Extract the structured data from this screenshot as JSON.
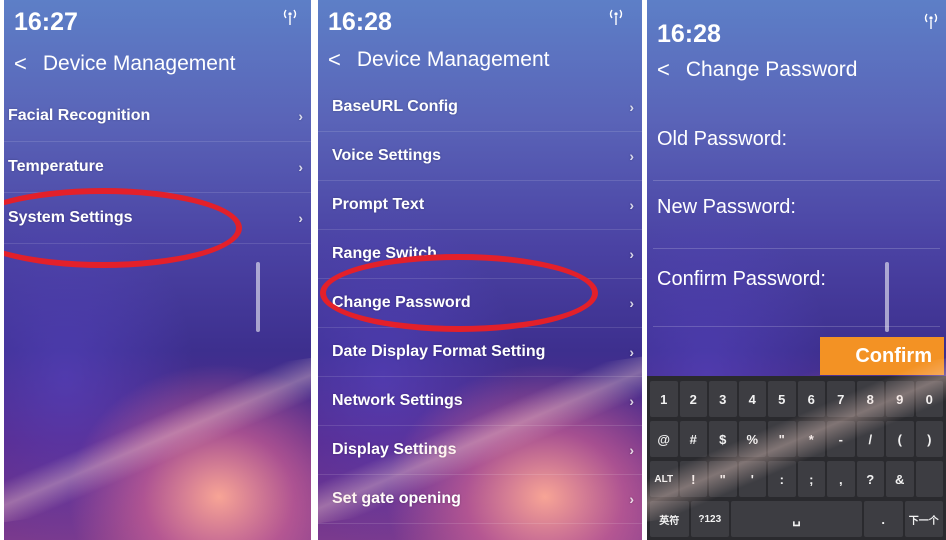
{
  "screens": [
    {
      "time": "16:27",
      "header_title": "Device Management",
      "menu_items": [
        "Facial Recognition",
        "Temperature",
        "System Settings"
      ]
    },
    {
      "time": "16:28",
      "header_title": "Device Management",
      "menu_items": [
        "BaseURL Config",
        "Voice Settings",
        "Prompt Text",
        "Range Switch",
        "Change Password",
        "Date Display Format Setting",
        "Network Settings",
        "Display Settings",
        "Set gate opening"
      ]
    },
    {
      "time": "16:28",
      "header_title": "Change Password",
      "fields": {
        "old_password": "Old Password:",
        "new_password": "New Password:",
        "confirm_password": "Confirm Password:"
      },
      "confirm_label": "Confirm",
      "keyboard": {
        "row1": [
          "1",
          "2",
          "3",
          "4",
          "5",
          "6",
          "7",
          "8",
          "9",
          "0"
        ],
        "row2": [
          "@",
          "#",
          "$",
          "%",
          "\"",
          "*",
          "-",
          "/",
          "(",
          ")"
        ],
        "row3": [
          "ALT",
          "!",
          "\"",
          "'",
          ":",
          ";",
          ",",
          "?",
          "&",
          ""
        ],
        "row4": [
          "英符",
          "?123",
          "␣",
          ".",
          "下一个"
        ]
      }
    }
  ],
  "icons": {
    "back": "chevron-left-icon",
    "signal": "wireless-signal-icon",
    "menu_arrow": "chevron-right-icon"
  },
  "colors": {
    "highlight_oval": "#e3202a",
    "confirm_button": "#f39224",
    "keyboard_bg": "#2a2a2e"
  }
}
